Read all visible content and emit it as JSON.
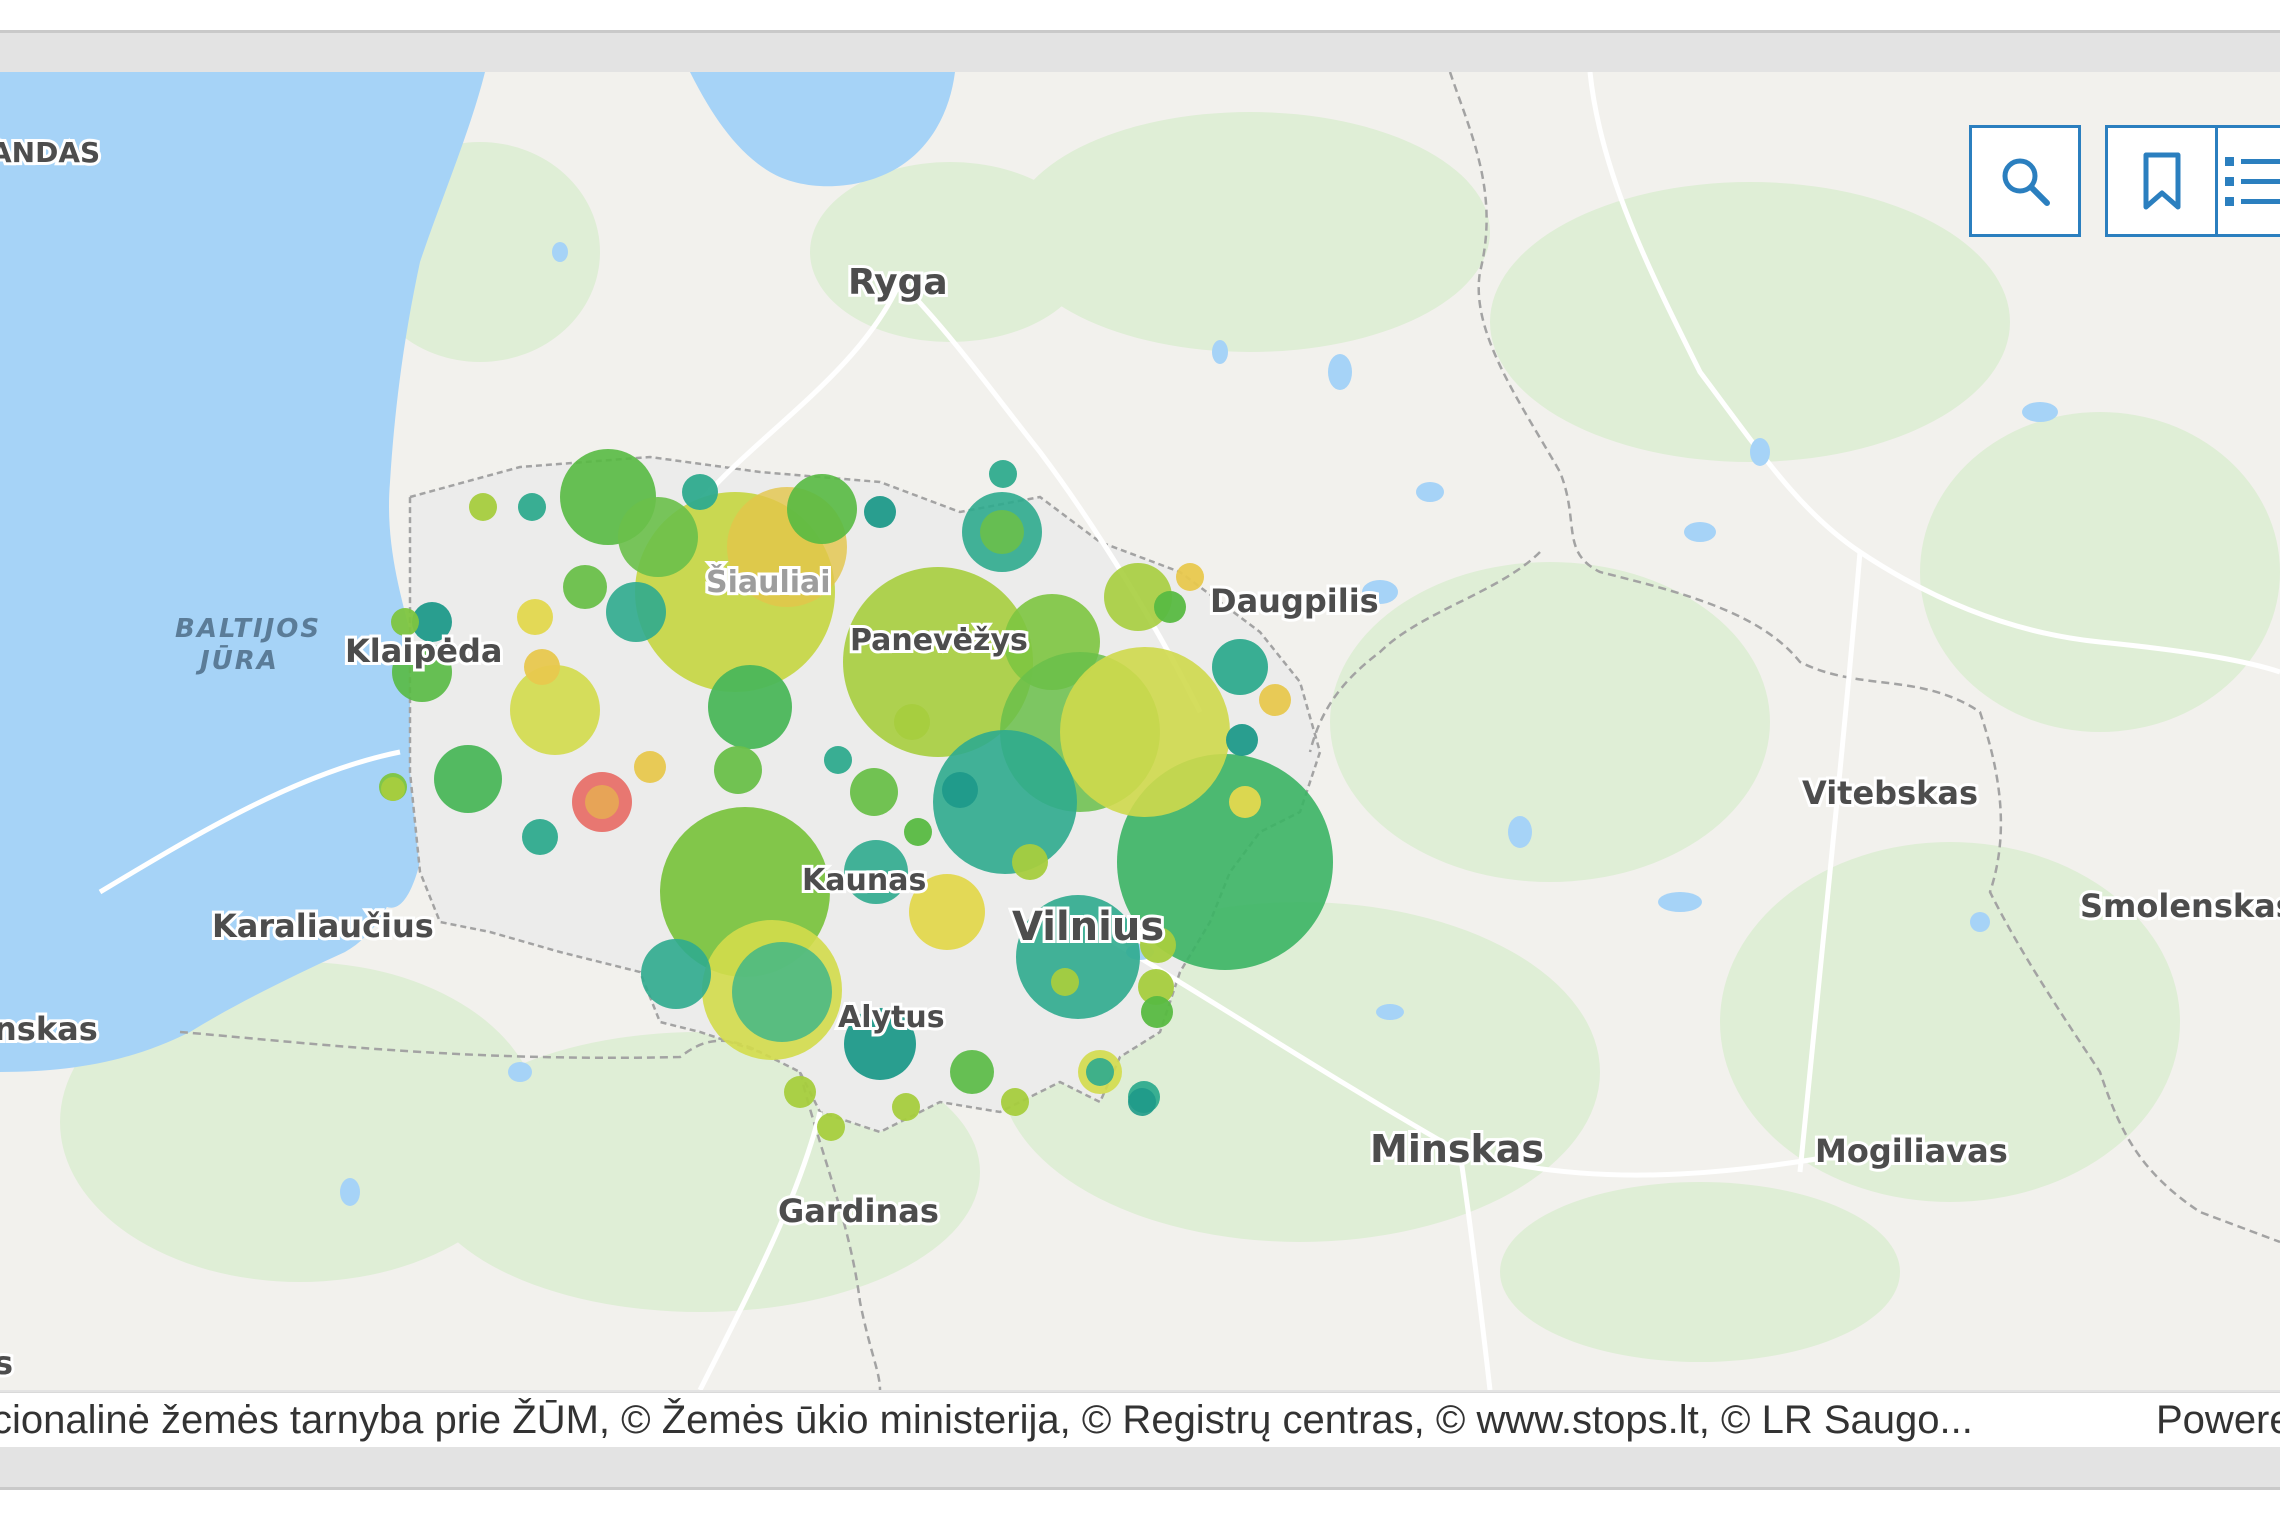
{
  "map": {
    "labels": {
      "ryga": "Ryga",
      "daugpilis": "Daugpilis",
      "klaipeda": "Klaipėda",
      "siauliai": "Šiauliai",
      "panevezys": "Panevėžys",
      "kaunas": "Kaunas",
      "vilnius": "Vilnius",
      "alytus": "Alytus",
      "gardinas": "Gardinas",
      "minskas": "Minskas",
      "mogiliavas": "Mogiliavas",
      "vitebskas": "Vitebskas",
      "smolenskas": "Smolenskas",
      "karaliaucius": "Karaliaučius",
      "gdanskas_partial": "nskas",
      "olandas_partial": "ANDAS",
      "sea_line1": "BALTIJOS",
      "sea_line2": "JŪRA",
      "left_partial": "s"
    },
    "colors": {
      "land": "#f2f1ed",
      "water": "#a6d3f7",
      "forest": "#dfeed6",
      "border": "#a3a3a3",
      "lithuania_fill": "#ececeb",
      "button_border": "#2b7fbf"
    }
  },
  "controls": {
    "search": "search-icon",
    "bookmarks": "bookmark-icon",
    "layers": "layer-list-icon"
  },
  "attribution": {
    "text": "cionalinė žemės tarnyba prie ŽŪM, © Žemės ūkio ministerija, © Registrų centras, © www.stops.lt, © LR Saugo...",
    "powered": "Powere"
  }
}
